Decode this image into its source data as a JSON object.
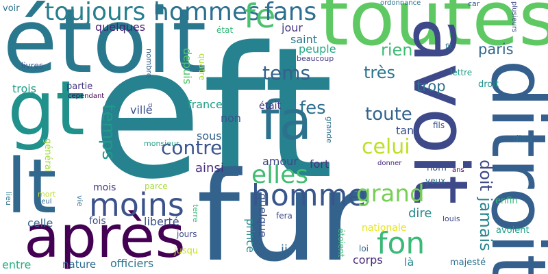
{
  "words": [
    {
      "text": "eft",
      "color": "#26828e"
    },
    {
      "text": "fur",
      "color": "#33638d"
    },
    {
      "text": "toutes",
      "color": "#5ec962"
    },
    {
      "text": "étoit",
      "color": "#2a788e"
    },
    {
      "text": "avoit",
      "color": "#3e4989"
    },
    {
      "text": "ditroit",
      "color": "#355f8d"
    },
    {
      "text": "gt",
      "color": "#21918c"
    },
    {
      "text": "lt",
      "color": "#31688e"
    },
    {
      "text": "après",
      "color": "#440154"
    },
    {
      "text": "fa",
      "color": "#2c728e"
    },
    {
      "text": "moins",
      "color": "#3b528b"
    },
    {
      "text": "homme",
      "color": "#39568c"
    },
    {
      "text": "toujours",
      "color": "#277f8e"
    },
    {
      "text": "hommes",
      "color": "#2c718e"
    },
    {
      "text": "fe",
      "color": "#4ac16d"
    },
    {
      "text": "fans",
      "color": "#2e6e8e"
    },
    {
      "text": "fon",
      "color": "#3aba76"
    },
    {
      "text": "elles",
      "color": "#40bd72"
    },
    {
      "text": "grand",
      "color": "#75d054"
    },
    {
      "text": "contre",
      "color": "#3a548c"
    },
    {
      "text": "celui",
      "color": "#bddf26"
    },
    {
      "text": "temps",
      "color": "#1f998a"
    },
    {
      "text": "toute",
      "color": "#32648e"
    },
    {
      "text": "tems",
      "color": "#34618d"
    },
    {
      "text": "fes",
      "color": "#2d708e"
    },
    {
      "text": "très",
      "color": "#2a778e"
    },
    {
      "text": "rien",
      "color": "#3dbc74"
    },
    {
      "text": "doit",
      "color": "#3f4889"
    },
    {
      "text": "jamais",
      "color": "#25848e"
    },
    {
      "text": "paris",
      "color": "#31678e"
    },
    {
      "text": "trop",
      "color": "#2d718e"
    },
    {
      "text": "quelques",
      "color": "#482173"
    },
    {
      "text": "jour",
      "color": "#453781"
    },
    {
      "text": "peuple",
      "color": "#22a884"
    },
    {
      "text": "saint",
      "color": "#2a788e"
    },
    {
      "text": "depuis",
      "color": "#52c569"
    },
    {
      "text": "dire",
      "color": "#23898e"
    },
    {
      "text": "ainsi",
      "color": "#472d7b"
    },
    {
      "text": "amour",
      "color": "#404688"
    },
    {
      "text": "france",
      "color": "#1fa088"
    },
    {
      "text": "non",
      "color": "#3b528b"
    },
    {
      "text": "sous",
      "color": "#33638d"
    },
    {
      "text": "était",
      "color": "#46327e"
    },
    {
      "text": "tant",
      "color": "#3b528b"
    },
    {
      "text": "fort",
      "color": "#46327e"
    },
    {
      "text": "quelque",
      "color": "#3b528b"
    },
    {
      "text": "prince",
      "color": "#238a8d"
    },
    {
      "text": "liberté",
      "color": "#3b528b"
    },
    {
      "text": "celle",
      "color": "#31688e"
    },
    {
      "text": "trois",
      "color": "#1fa188"
    },
    {
      "text": "partie",
      "color": "#453781"
    },
    {
      "text": "ville",
      "color": "#3b528b"
    },
    {
      "text": "mois",
      "color": "#443983"
    },
    {
      "text": "fois",
      "color": "#3d4e8a"
    },
    {
      "text": "officiers",
      "color": "#2c728e"
    },
    {
      "text": "nature",
      "color": "#2f6c8e"
    },
    {
      "text": "entre",
      "color": "#29af7f"
    },
    {
      "text": "corps",
      "color": "#482878"
    },
    {
      "text": "ii",
      "color": "#31688e"
    },
    {
      "text": "là",
      "color": "#23898e"
    },
    {
      "text": "majesté",
      "color": "#2c718e"
    },
    {
      "text": "nationale",
      "color": "#e7e419"
    },
    {
      "text": "loi",
      "color": "#32648e"
    },
    {
      "text": "étoient",
      "color": "#3dbc74"
    },
    {
      "text": "fera",
      "color": "#3e4a89"
    },
    {
      "text": "jusqu",
      "color": "#c8e020"
    },
    {
      "text": "jours",
      "color": "#3e4a89"
    },
    {
      "text": "vie",
      "color": "#2d708e"
    },
    {
      "text": "terre",
      "color": "#38b977"
    },
    {
      "text": "parce",
      "color": "#a8db34"
    },
    {
      "text": "mort",
      "color": "#bddf26"
    },
    {
      "text": "seul",
      "color": "#31688e"
    },
    {
      "text": "lieu",
      "color": "#2a788e"
    },
    {
      "text": "général",
      "color": "#a2da37"
    },
    {
      "text": "voir",
      "color": "#2c718e"
    },
    {
      "text": "livres",
      "color": "#39568c"
    },
    {
      "text": "cependant",
      "color": "#440154"
    },
    {
      "text": "ci",
      "color": "#453781"
    },
    {
      "text": "nombre",
      "color": "#33638d"
    },
    {
      "text": "quatre",
      "color": "#addc30"
    },
    {
      "text": "état",
      "color": "#35b779"
    },
    {
      "text": "beaucoup",
      "color": "#443a83"
    },
    {
      "text": "ordonnance",
      "color": "#2c728e"
    },
    {
      "text": "car",
      "color": "#3b528b"
    },
    {
      "text": "plusieurs",
      "color": "#3e4c8a"
    },
    {
      "text": "fit",
      "color": "#2c728e"
    },
    {
      "text": "lettre",
      "color": "#1f9e89"
    },
    {
      "text": "droit",
      "color": "#21918c"
    },
    {
      "text": "fils",
      "color": "#3b528b"
    },
    {
      "text": "dieu",
      "color": "#2c718e"
    },
    {
      "text": "grande",
      "color": "#2c718e"
    },
    {
      "text": "monsieur",
      "color": "#20a386"
    },
    {
      "text": "donner",
      "color": "#482878"
    },
    {
      "text": "ans",
      "color": "#440154"
    },
    {
      "text": "nom",
      "color": "#3e4a89"
    },
    {
      "text": "yeux",
      "color": "#2c728e"
    },
    {
      "text": "enfin",
      "color": "#37b878"
    },
    {
      "text": "louis",
      "color": "#3e4a89"
    },
    {
      "text": "avoient",
      "color": "#1fa088"
    }
  ]
}
